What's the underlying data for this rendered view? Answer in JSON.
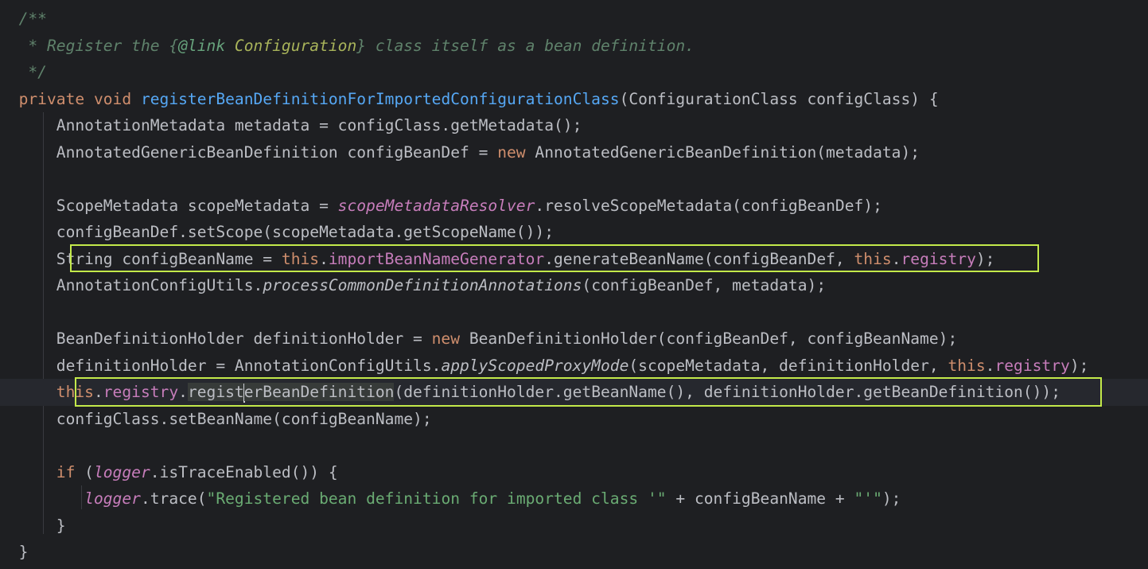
{
  "editor": {
    "lines": [
      {
        "id": "l1",
        "tokens": [
          {
            "text": "  /**",
            "cls": "doc"
          }
        ]
      },
      {
        "id": "l2",
        "tokens": [
          {
            "text": "   * Register the {",
            "cls": "doc"
          },
          {
            "text": "@link",
            "cls": "doctag"
          },
          {
            "text": " Configuration",
            "cls": "docref"
          },
          {
            "text": "} class itself as a bean definition.",
            "cls": "doc"
          }
        ]
      },
      {
        "id": "l3",
        "tokens": [
          {
            "text": "   */",
            "cls": "doc"
          }
        ]
      },
      {
        "id": "l4",
        "tokens": [
          {
            "text": "  private void ",
            "cls": "kw"
          },
          {
            "text": "registerBeanDefinitionForImportedConfigurationClass",
            "cls": "fn"
          },
          {
            "text": "(ConfigurationClass configClass) {",
            "cls": ""
          }
        ]
      },
      {
        "id": "l5",
        "tokens": [
          {
            "text": "      AnnotationMetadata metadata = configClass.getMetadata();",
            "cls": ""
          }
        ]
      },
      {
        "id": "l6",
        "tokens": [
          {
            "text": "      AnnotatedGenericBeanDefinition configBeanDef = ",
            "cls": ""
          },
          {
            "text": "new",
            "cls": "kw"
          },
          {
            "text": " AnnotatedGenericBeanDefinition(metadata);",
            "cls": ""
          }
        ]
      },
      {
        "id": "l7",
        "tokens": [
          {
            "text": "",
            "cls": ""
          }
        ]
      },
      {
        "id": "l8",
        "tokens": [
          {
            "text": "      ScopeMetadata scopeMetadata = ",
            "cls": ""
          },
          {
            "text": "scopeMetadataResolver",
            "cls": "static"
          },
          {
            "text": ".resolveScopeMetadata(configBeanDef);",
            "cls": ""
          }
        ]
      },
      {
        "id": "l9",
        "tokens": [
          {
            "text": "      configBeanDef.setScope(scopeMetadata.getScopeName());",
            "cls": ""
          }
        ]
      },
      {
        "id": "l10",
        "tokens": [
          {
            "text": "      String configBeanName = ",
            "cls": ""
          },
          {
            "text": "this",
            "cls": "kw"
          },
          {
            "text": ".",
            "cls": ""
          },
          {
            "text": "importBeanNameGenerator",
            "cls": "mem"
          },
          {
            "text": ".generateBeanName(configBeanDef, ",
            "cls": ""
          },
          {
            "text": "this",
            "cls": "kw"
          },
          {
            "text": ".",
            "cls": ""
          },
          {
            "text": "registry",
            "cls": "mem"
          },
          {
            "text": ");",
            "cls": ""
          }
        ]
      },
      {
        "id": "l11",
        "tokens": [
          {
            "text": "      AnnotationConfigUtils.",
            "cls": ""
          },
          {
            "text": "processCommonDefinitionAnnotations",
            "cls": "smeth"
          },
          {
            "text": "(configBeanDef, metadata);",
            "cls": ""
          }
        ]
      },
      {
        "id": "l12",
        "tokens": [
          {
            "text": "",
            "cls": ""
          }
        ]
      },
      {
        "id": "l13",
        "tokens": [
          {
            "text": "      BeanDefinitionHolder definitionHolder = ",
            "cls": ""
          },
          {
            "text": "new",
            "cls": "kw"
          },
          {
            "text": " BeanDefinitionHolder(configBeanDef, configBeanName);",
            "cls": ""
          }
        ]
      },
      {
        "id": "l14",
        "tokens": [
          {
            "text": "      definitionHolder = AnnotationConfigUtils.",
            "cls": ""
          },
          {
            "text": "applyScopedProxyMode",
            "cls": "smeth"
          },
          {
            "text": "(scopeMetadata, definitionHolder, ",
            "cls": ""
          },
          {
            "text": "this",
            "cls": "kw"
          },
          {
            "text": ".",
            "cls": ""
          },
          {
            "text": "registry",
            "cls": "mem"
          },
          {
            "text": ");",
            "cls": ""
          }
        ]
      },
      {
        "id": "l15",
        "current": true,
        "tokens": [
          {
            "text": "      ",
            "cls": ""
          },
          {
            "text": "this",
            "cls": "kw"
          },
          {
            "text": ".",
            "cls": ""
          },
          {
            "text": "registry",
            "cls": "mem"
          },
          {
            "text": ".",
            "cls": ""
          },
          {
            "text": "regist",
            "cls": "ident-hl"
          },
          {
            "caret": true
          },
          {
            "text": "erBeanDefinition",
            "cls": "ident-hl"
          },
          {
            "text": "(definitionHolder.getBeanName(), definitionHolder.getBeanDefinition());",
            "cls": ""
          }
        ]
      },
      {
        "id": "l16",
        "tokens": [
          {
            "text": "      configClass.setBeanName(configBeanName);",
            "cls": ""
          }
        ]
      },
      {
        "id": "l17",
        "tokens": [
          {
            "text": "",
            "cls": ""
          }
        ]
      },
      {
        "id": "l18",
        "tokens": [
          {
            "text": "      ",
            "cls": ""
          },
          {
            "text": "if",
            "cls": "kw"
          },
          {
            "text": " (",
            "cls": ""
          },
          {
            "text": "logger",
            "cls": "static"
          },
          {
            "text": ".isTraceEnabled()) {",
            "cls": ""
          }
        ]
      },
      {
        "id": "l19",
        "tokens": [
          {
            "text": "         ",
            "cls": ""
          },
          {
            "text": "logger",
            "cls": "static"
          },
          {
            "text": ".trace(",
            "cls": ""
          },
          {
            "text": "\"Registered bean definition for imported class '\"",
            "cls": "str"
          },
          {
            "text": " + configBeanName + ",
            "cls": ""
          },
          {
            "text": "\"'\"",
            "cls": "str"
          },
          {
            "text": ");",
            "cls": ""
          }
        ]
      },
      {
        "id": "l20",
        "tokens": [
          {
            "text": "      }",
            "cls": ""
          }
        ]
      },
      {
        "id": "l21",
        "tokens": [
          {
            "text": "  }",
            "cls": ""
          }
        ]
      }
    ]
  }
}
